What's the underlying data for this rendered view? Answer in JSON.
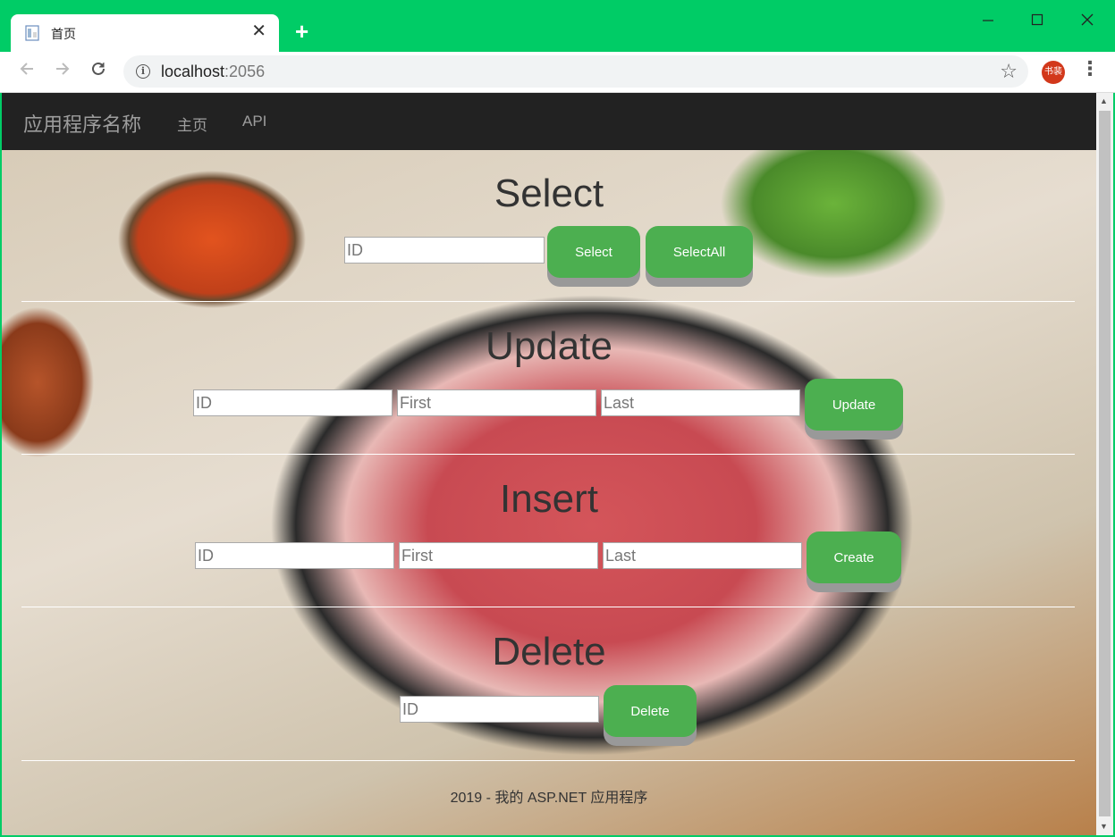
{
  "browser": {
    "tab_title": "首页",
    "tab_close": "✕",
    "new_tab": "+",
    "url_host": "localhost",
    "url_port": ":2056",
    "profile": "书裴"
  },
  "nav": {
    "brand": "应用程序名称",
    "links": [
      "主页",
      "API"
    ]
  },
  "select": {
    "title": "Select",
    "id_placeholder": "ID",
    "select_label": "Select",
    "selectall_label": "SelectAll"
  },
  "update": {
    "title": "Update",
    "id_placeholder": "ID",
    "first_placeholder": "First",
    "last_placeholder": "Last",
    "button_label": "Update"
  },
  "insert": {
    "title": "Insert",
    "id_placeholder": "ID",
    "first_placeholder": "First",
    "last_placeholder": "Last",
    "button_label": "Create"
  },
  "delete": {
    "title": "Delete",
    "id_placeholder": "ID",
    "button_label": "Delete"
  },
  "footer": "2019 - 我的 ASP.NET 应用程序",
  "colors": {
    "button": "#4caf50",
    "navbar": "#222222",
    "titlebar": "#00cc66"
  }
}
